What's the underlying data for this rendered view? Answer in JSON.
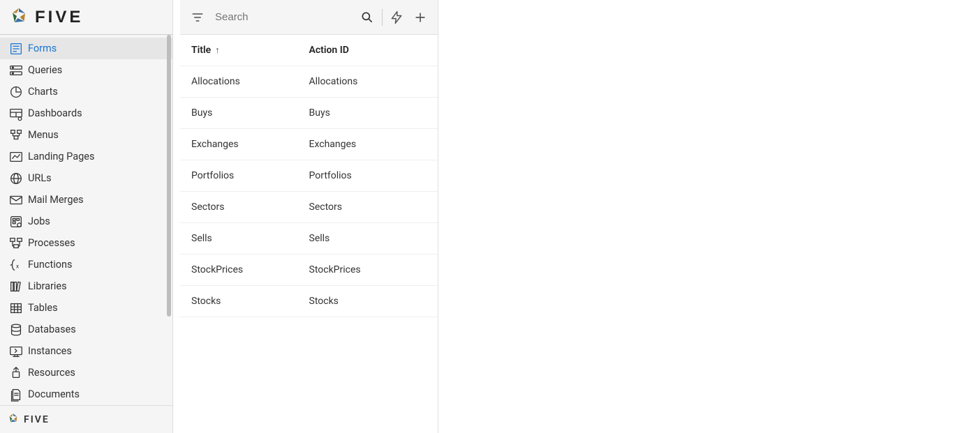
{
  "brand": {
    "name_upper": "FIVE",
    "name_lower": "FIVE"
  },
  "sidebar": {
    "items": [
      {
        "id": "forms",
        "label": "Forms",
        "active": true
      },
      {
        "id": "queries",
        "label": "Queries",
        "active": false
      },
      {
        "id": "charts",
        "label": "Charts",
        "active": false
      },
      {
        "id": "dashboards",
        "label": "Dashboards",
        "active": false
      },
      {
        "id": "menus",
        "label": "Menus",
        "active": false
      },
      {
        "id": "landing",
        "label": "Landing Pages",
        "active": false
      },
      {
        "id": "urls",
        "label": "URLs",
        "active": false
      },
      {
        "id": "mailmerges",
        "label": "Mail Merges",
        "active": false
      },
      {
        "id": "jobs",
        "label": "Jobs",
        "active": false
      },
      {
        "id": "processes",
        "label": "Processes",
        "active": false
      },
      {
        "id": "functions",
        "label": "Functions",
        "active": false
      },
      {
        "id": "libraries",
        "label": "Libraries",
        "active": false
      },
      {
        "id": "tables",
        "label": "Tables",
        "active": false
      },
      {
        "id": "databases",
        "label": "Databases",
        "active": false
      },
      {
        "id": "instances",
        "label": "Instances",
        "active": false
      },
      {
        "id": "resources",
        "label": "Resources",
        "active": false
      },
      {
        "id": "documents",
        "label": "Documents",
        "active": false
      }
    ]
  },
  "toolbar": {
    "search_placeholder": "Search"
  },
  "columns": {
    "title": "Title",
    "action_id": "Action ID",
    "sort_indicator": "↑"
  },
  "rows": [
    {
      "title": "Allocations",
      "action_id": "Allocations"
    },
    {
      "title": "Buys",
      "action_id": "Buys"
    },
    {
      "title": "Exchanges",
      "action_id": "Exchanges"
    },
    {
      "title": "Portfolios",
      "action_id": "Portfolios"
    },
    {
      "title": "Sectors",
      "action_id": "Sectors"
    },
    {
      "title": "Sells",
      "action_id": "Sells"
    },
    {
      "title": "StockPrices",
      "action_id": "StockPrices"
    },
    {
      "title": "Stocks",
      "action_id": "Stocks"
    }
  ]
}
